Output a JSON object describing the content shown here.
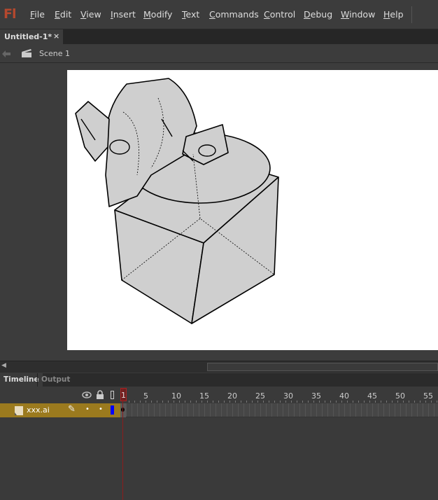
{
  "app": {
    "logo": "Fl"
  },
  "menu": [
    "File",
    "Edit",
    "View",
    "Insert",
    "Modify",
    "Text",
    "Commands",
    "Control",
    "Debug",
    "Window",
    "Help"
  ],
  "document_tab": {
    "title": "Untitled-1*",
    "close": "×"
  },
  "scene": {
    "label": "Scene 1"
  },
  "panel_tabs": [
    "Timeline",
    "Output"
  ],
  "timeline": {
    "frame_numbers": [
      "1",
      "5",
      "10",
      "15",
      "20",
      "25",
      "30",
      "35",
      "40",
      "45",
      "50",
      "55"
    ],
    "current_frame": 1,
    "layers": [
      {
        "name": "xxx.ai",
        "color": "#0000ff"
      }
    ]
  }
}
